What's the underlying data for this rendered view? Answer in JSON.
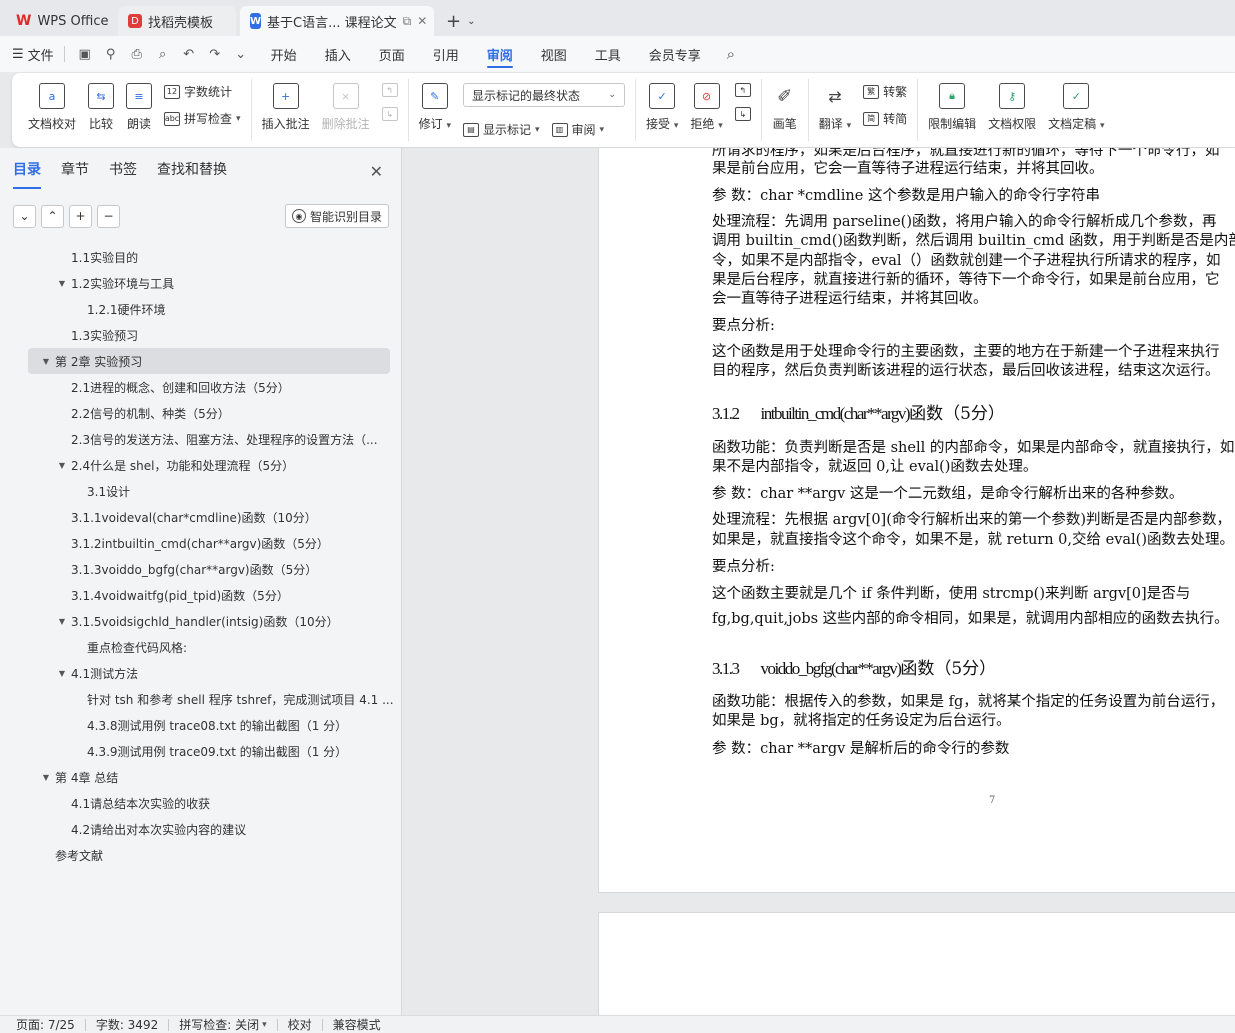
{
  "titlebar": {
    "tabs": [
      {
        "label": "WPS Office",
        "icon": "wps-logo-icon"
      },
      {
        "label": "找稻壳模板",
        "icon": "docer-logo-icon"
      },
      {
        "label": "基于C语言... 课程论文",
        "icon": "wps-writer-icon",
        "active": true
      }
    ],
    "new_tab": "+"
  },
  "menu": {
    "file": "文件",
    "tabs": [
      "开始",
      "插入",
      "页面",
      "引用",
      "审阅",
      "视图",
      "工具",
      "会员专享"
    ],
    "active_tab": "审阅"
  },
  "ribbon": {
    "doc_proof": "文档校对",
    "compare": "比较",
    "read_aloud": "朗读",
    "word_count": "字数统计",
    "spell_check": "拼写检查",
    "insert_comment": "插入批注",
    "delete_comment": "删除批注",
    "revise": "修订",
    "markup_state": "显示标记的最终状态",
    "show_markup": "显示标记",
    "review_pane": "审阅",
    "accept": "接受",
    "reject": "拒绝",
    "pen": "画笔",
    "translate": "翻译",
    "to_traditional": "转繁",
    "to_simplified": "转简",
    "restrict_edit": "限制编辑",
    "doc_permission": "文档权限",
    "doc_finalize": "文档定稿"
  },
  "sidebar": {
    "tabs": [
      "目录",
      "章节",
      "书签",
      "查找和替换"
    ],
    "active_tab": "目录",
    "smart_toc": "智能识别目录",
    "toc": [
      {
        "text": "1.1实验目的",
        "level": 2,
        "toggle": ""
      },
      {
        "text": "1.2实验环境与工具",
        "level": 2,
        "toggle": "▼"
      },
      {
        "text": "1.2.1硬件环境",
        "level": 3,
        "toggle": ""
      },
      {
        "text": "1.3实验预习",
        "level": 2,
        "toggle": ""
      },
      {
        "text": "第 2章 实验预习",
        "level": 1,
        "toggle": "▼",
        "selected": true
      },
      {
        "text": "2.1进程的概念、创建和回收方法（5分）",
        "level": 2,
        "toggle": ""
      },
      {
        "text": "2.2信号的机制、种类（5分）",
        "level": 2,
        "toggle": ""
      },
      {
        "text": "2.3信号的发送方法、阻塞方法、处理程序的设置方法（...",
        "level": 2,
        "toggle": ""
      },
      {
        "text": "2.4什么是 shel，功能和处理流程（5分）",
        "level": 2,
        "toggle": "▼"
      },
      {
        "text": "3.1设计",
        "level": 3,
        "toggle": ""
      },
      {
        "text": "3.1.1voideval(char*cmdline)函数（10分）",
        "level": 2,
        "toggle": ""
      },
      {
        "text": "3.1.2intbuiltin_cmd(char**argv)函数（5分）",
        "level": 2,
        "toggle": ""
      },
      {
        "text": "3.1.3voiddo_bgfg(char**argv)函数（5分）",
        "level": 2,
        "toggle": ""
      },
      {
        "text": "3.1.4voidwaitfg(pid_tpid)函数（5分）",
        "level": 2,
        "toggle": ""
      },
      {
        "text": "3.1.5voidsigchld_handler(intsig)函数（10分）",
        "level": 2,
        "toggle": "▼"
      },
      {
        "text": "重点检查代码风格:",
        "level": 3,
        "toggle": ""
      },
      {
        "text": "4.1测试方法",
        "level": 2,
        "toggle": "▼"
      },
      {
        "text": "针对 tsh 和参考 shell 程序 tshref，完成测试项目 4.1 ...",
        "level": 3,
        "toggle": ""
      },
      {
        "text": "4.3.8测试用例 trace08.txt 的输出截图（1 分）",
        "level": 3,
        "toggle": ""
      },
      {
        "text": "4.3.9测试用例 trace09.txt 的输出截图（1 分）",
        "level": 3,
        "toggle": ""
      },
      {
        "text": "第 4章 总结",
        "level": 1,
        "toggle": "▼"
      },
      {
        "text": "4.1请总结本次实验的收获",
        "level": 2,
        "toggle": ""
      },
      {
        "text": "4.2请给出对本次实验内容的建议",
        "level": 2,
        "toggle": ""
      },
      {
        "text": "参考文献",
        "level": 1,
        "toggle": ""
      }
    ]
  },
  "document": {
    "lines": [
      "所请求的程序，如果是后台程序，就直接进行新的循环，等待下一个命令行，如",
      "果是前台应用，它会一直等待子进程运行结束，并将其回收。",
      "参  数：char *cmdline  这个参数是用户输入的命令行字符串",
      "处理流程：先调用  parseline()函数，将用户输入的命令行解析成几个参数，再",
      "调用  builtin_cmd()函数判断，然后调用  builtin_cmd 函数，用于判断是否是内部",
      "令，如果不是内部指令，eval（）函数就创建一个子进程执行所请求的程序，如",
      "果是后台程序，就直接进行新的循环，等待下一个命令行，如果是前台应用，它",
      "会一直等待子进程运行结束，并将其回收。",
      "要点分析:",
      "这个函数是用于处理命令行的主要函数，主要的地方在于新建一个子进程来执行",
      "目的程序，然后负责判断该进程的运行状态，最后回收该进程，结束这次运行。"
    ],
    "heading1": {
      "num": "3.1.2",
      "code": "intbuiltin_cmd(char**argv)",
      "rest": "函数（5分）"
    },
    "lines2": [
      "函数功能：负责判断是否是  shell 的内部命令，如果是内部命令，就直接执行，如",
      "果不是内部指令，就返回  0,让  eval()函数去处理。",
      "参  数：char **argv 这是一个二元数组，是命令行解析出来的各种参数。",
      "处理流程：先根据  argv[0](命令行解析出来的第一个参数)判断是否是内部参数，",
      "如果是，就直接指令这个命令，如果不是，就  return 0,交给  eval()函数去处理。",
      "要点分析:",
      "        这个函数主要就是几个  if 条件判断，使用  strcmp()来判断  argv[0]是否与",
      "fg,bg,quit,jobs 这些内部的命令相同，如果是，就调用内部相应的函数去执行。"
    ],
    "heading2": {
      "num": "3.1.3",
      "code": "voiddo_bgfg(char**argv)",
      "rest": "函数（5分）"
    },
    "lines3": [
      "函数功能：根据传入的参数，如果是  fg，就将某个指定的任务设置为前台运行，",
      "如果是  bg，就将指定的任务设定为后台运行。",
      "参  数：char **argv 是解析后的命令行的参数"
    ],
    "page_number": "7"
  },
  "status": {
    "page": "页面: 7/25",
    "words": "字数: 3492",
    "spell": "拼写检查: 关闭",
    "proof": "校对",
    "compat": "兼容模式"
  }
}
